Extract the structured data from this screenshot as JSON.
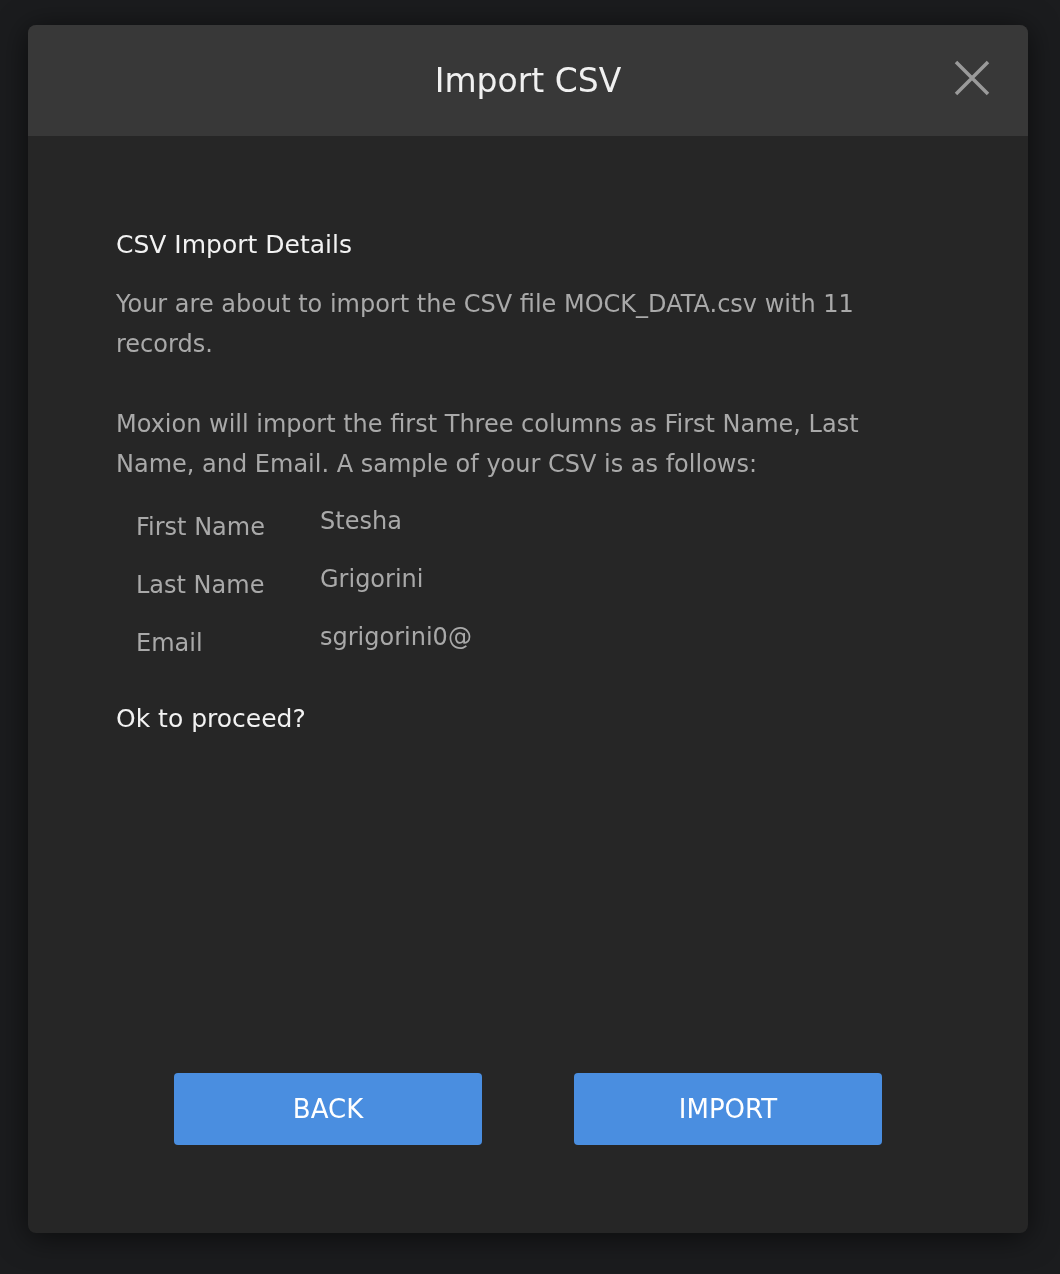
{
  "dialog": {
    "title": "Import CSV",
    "section_title": "CSV Import Details",
    "paragraphs": [
      "Your are about to import the CSV file MOCK_DATA.csv with 11 records.",
      "Moxion will import the first Three columns as First Name, Last Name, and Email. A sample of your CSV is as follows:"
    ],
    "sample": [
      {
        "label": "First Name",
        "value": "Stesha"
      },
      {
        "label": "Last Name",
        "value": "Grigorini"
      },
      {
        "label": "Email",
        "value": "sgrigorini0@"
      }
    ],
    "question": "Ok to proceed?",
    "buttons": [
      "BACK",
      "IMPORT"
    ]
  }
}
